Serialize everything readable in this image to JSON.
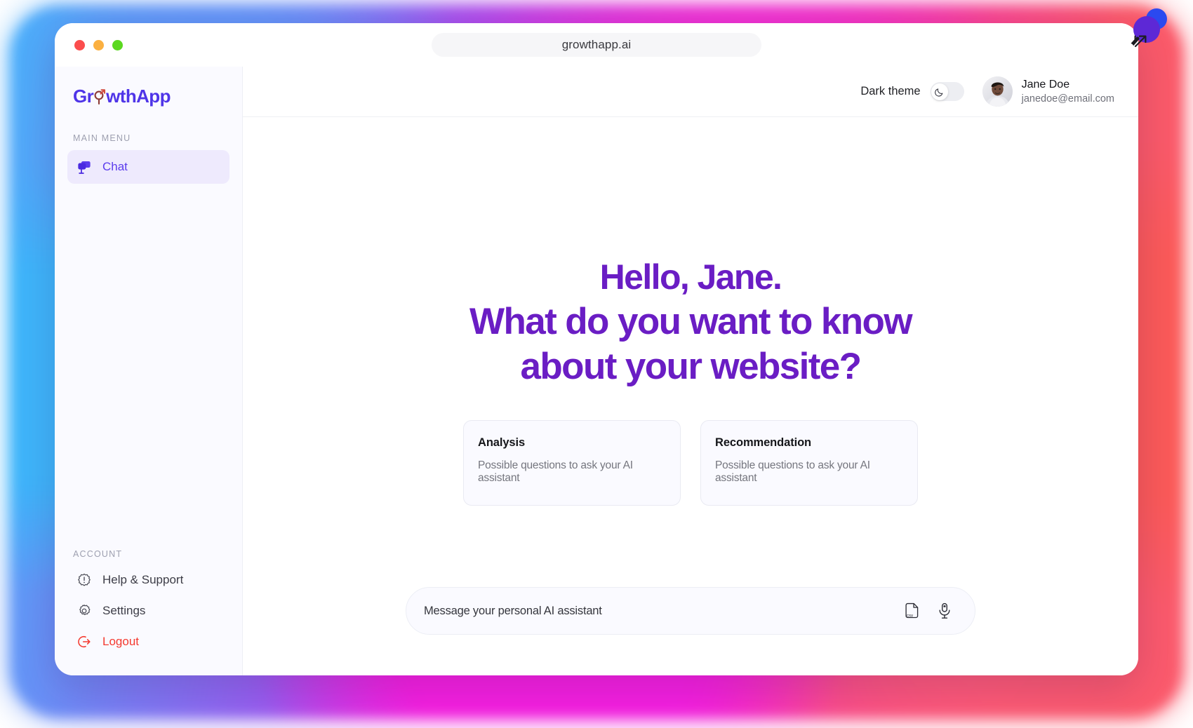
{
  "browser": {
    "url": "growthapp.ai",
    "traffic_lights": [
      "close",
      "minimize",
      "maximize"
    ]
  },
  "sidebar": {
    "logo": {
      "prefix": "Gr",
      "mark_icon": "person-arrow-icon",
      "suffix": "wthApp"
    },
    "main_menu_label": "MAIN MENU",
    "menu_items": [
      {
        "label": "Chat",
        "icon": "chat-bubbles-icon",
        "active": true
      }
    ],
    "account_label": "ACCOUNT",
    "account_items": [
      {
        "label": "Help & Support",
        "icon": "help-badge-icon",
        "danger": false
      },
      {
        "label": "Settings",
        "icon": "gear-icon",
        "danger": false
      },
      {
        "label": "Logout",
        "icon": "logout-icon",
        "danger": true
      }
    ]
  },
  "topbar": {
    "theme_label": "Dark theme",
    "theme_enabled": false,
    "theme_icon": "moon-icon",
    "profile": {
      "name": "Jane Doe",
      "email": "janedoe@email.com",
      "avatar_icon": "user-avatar"
    }
  },
  "hero": {
    "line1": "Hello, Jane.",
    "line2": "What do you want to know",
    "line3": "about your website?"
  },
  "cards": [
    {
      "title": "Analysis",
      "subtitle": "Possible questions to ask your AI assistant"
    },
    {
      "title": "Recommendation",
      "subtitle": "Possible questions to ask your AI assistant"
    }
  ],
  "composer": {
    "placeholder": "Message your personal AI assistant",
    "value": "",
    "actions": [
      {
        "icon": "csv-file-icon",
        "label": "csv"
      },
      {
        "icon": "microphone-icon",
        "label": "mic"
      }
    ]
  },
  "decorations": {
    "magnifier_icon": "magnifier-circles-icon",
    "cursor_icon": "resize-arrow-icon"
  },
  "colors": {
    "brand_purple": "#4f35e8",
    "hero_purple": "#6a1dc4",
    "accent_active": "#5b3ced",
    "danger_red": "#f4392f",
    "gradient_blue": "#49b2fb",
    "gradient_magenta": "#f221da",
    "gradient_coral": "#fb5a6a"
  }
}
